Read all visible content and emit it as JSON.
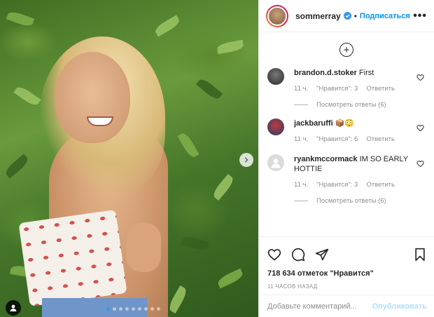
{
  "header": {
    "username": "sommerray",
    "separator": "•",
    "follow_label": "Подписаться",
    "more_icon": "more-horizontal-icon"
  },
  "add_button": {
    "glyph": "+",
    "icon": "plus-circle-icon"
  },
  "comments": [
    {
      "username": "brandon.d.stoker",
      "text": "First",
      "time": "11 ч.",
      "likes": "\"Нравится\": 3",
      "reply": "Ответить",
      "replies": "Посмотреть ответы (6)",
      "avatar_color": "#3a3a3a"
    },
    {
      "username": "jackbaruffi",
      "text": "📦😳",
      "time": "11 ч.",
      "likes": "\"Нравится\": 6",
      "reply": "Ответить",
      "avatar_color": "#2d5c8c"
    },
    {
      "username": "ryankmccormack",
      "text": "IM SO EARLY HOTTIE",
      "time": "11 ч.",
      "likes": "\"Нравится\": 3",
      "reply": "Ответить",
      "replies": "Посмотреть ответы (6)",
      "avatar_color": "#dbdbdb"
    }
  ],
  "post": {
    "likes": "718 634 отметок \"Нравится\"",
    "time": "11 ЧАСОВ НАЗАД",
    "carousel_dots": 9,
    "active_dot": 0
  },
  "comment_box": {
    "placeholder": "Добавьте комментарий...",
    "publish_label": "Опубликовать"
  },
  "colors": {
    "accent": "#0095f6",
    "publish_disabled": "#b2dffc",
    "secondary_text": "#8e8e8e"
  }
}
